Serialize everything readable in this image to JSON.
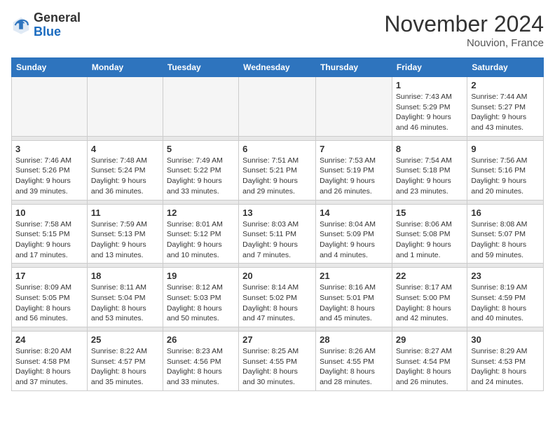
{
  "header": {
    "logo_general": "General",
    "logo_blue": "Blue",
    "month_title": "November 2024",
    "location": "Nouvion, France"
  },
  "columns": [
    "Sunday",
    "Monday",
    "Tuesday",
    "Wednesday",
    "Thursday",
    "Friday",
    "Saturday"
  ],
  "weeks": [
    {
      "days": [
        {
          "num": "",
          "info": "",
          "empty": true
        },
        {
          "num": "",
          "info": "",
          "empty": true
        },
        {
          "num": "",
          "info": "",
          "empty": true
        },
        {
          "num": "",
          "info": "",
          "empty": true
        },
        {
          "num": "",
          "info": "",
          "empty": true
        },
        {
          "num": "1",
          "info": "Sunrise: 7:43 AM\nSunset: 5:29 PM\nDaylight: 9 hours\nand 46 minutes."
        },
        {
          "num": "2",
          "info": "Sunrise: 7:44 AM\nSunset: 5:27 PM\nDaylight: 9 hours\nand 43 minutes."
        }
      ]
    },
    {
      "days": [
        {
          "num": "3",
          "info": "Sunrise: 7:46 AM\nSunset: 5:26 PM\nDaylight: 9 hours\nand 39 minutes."
        },
        {
          "num": "4",
          "info": "Sunrise: 7:48 AM\nSunset: 5:24 PM\nDaylight: 9 hours\nand 36 minutes."
        },
        {
          "num": "5",
          "info": "Sunrise: 7:49 AM\nSunset: 5:22 PM\nDaylight: 9 hours\nand 33 minutes."
        },
        {
          "num": "6",
          "info": "Sunrise: 7:51 AM\nSunset: 5:21 PM\nDaylight: 9 hours\nand 29 minutes."
        },
        {
          "num": "7",
          "info": "Sunrise: 7:53 AM\nSunset: 5:19 PM\nDaylight: 9 hours\nand 26 minutes."
        },
        {
          "num": "8",
          "info": "Sunrise: 7:54 AM\nSunset: 5:18 PM\nDaylight: 9 hours\nand 23 minutes."
        },
        {
          "num": "9",
          "info": "Sunrise: 7:56 AM\nSunset: 5:16 PM\nDaylight: 9 hours\nand 20 minutes."
        }
      ]
    },
    {
      "days": [
        {
          "num": "10",
          "info": "Sunrise: 7:58 AM\nSunset: 5:15 PM\nDaylight: 9 hours\nand 17 minutes."
        },
        {
          "num": "11",
          "info": "Sunrise: 7:59 AM\nSunset: 5:13 PM\nDaylight: 9 hours\nand 13 minutes."
        },
        {
          "num": "12",
          "info": "Sunrise: 8:01 AM\nSunset: 5:12 PM\nDaylight: 9 hours\nand 10 minutes."
        },
        {
          "num": "13",
          "info": "Sunrise: 8:03 AM\nSunset: 5:11 PM\nDaylight: 9 hours\nand 7 minutes."
        },
        {
          "num": "14",
          "info": "Sunrise: 8:04 AM\nSunset: 5:09 PM\nDaylight: 9 hours\nand 4 minutes."
        },
        {
          "num": "15",
          "info": "Sunrise: 8:06 AM\nSunset: 5:08 PM\nDaylight: 9 hours\nand 1 minute."
        },
        {
          "num": "16",
          "info": "Sunrise: 8:08 AM\nSunset: 5:07 PM\nDaylight: 8 hours\nand 59 minutes."
        }
      ]
    },
    {
      "days": [
        {
          "num": "17",
          "info": "Sunrise: 8:09 AM\nSunset: 5:05 PM\nDaylight: 8 hours\nand 56 minutes."
        },
        {
          "num": "18",
          "info": "Sunrise: 8:11 AM\nSunset: 5:04 PM\nDaylight: 8 hours\nand 53 minutes."
        },
        {
          "num": "19",
          "info": "Sunrise: 8:12 AM\nSunset: 5:03 PM\nDaylight: 8 hours\nand 50 minutes."
        },
        {
          "num": "20",
          "info": "Sunrise: 8:14 AM\nSunset: 5:02 PM\nDaylight: 8 hours\nand 47 minutes."
        },
        {
          "num": "21",
          "info": "Sunrise: 8:16 AM\nSunset: 5:01 PM\nDaylight: 8 hours\nand 45 minutes."
        },
        {
          "num": "22",
          "info": "Sunrise: 8:17 AM\nSunset: 5:00 PM\nDaylight: 8 hours\nand 42 minutes."
        },
        {
          "num": "23",
          "info": "Sunrise: 8:19 AM\nSunset: 4:59 PM\nDaylight: 8 hours\nand 40 minutes."
        }
      ]
    },
    {
      "days": [
        {
          "num": "24",
          "info": "Sunrise: 8:20 AM\nSunset: 4:58 PM\nDaylight: 8 hours\nand 37 minutes."
        },
        {
          "num": "25",
          "info": "Sunrise: 8:22 AM\nSunset: 4:57 PM\nDaylight: 8 hours\nand 35 minutes."
        },
        {
          "num": "26",
          "info": "Sunrise: 8:23 AM\nSunset: 4:56 PM\nDaylight: 8 hours\nand 33 minutes."
        },
        {
          "num": "27",
          "info": "Sunrise: 8:25 AM\nSunset: 4:55 PM\nDaylight: 8 hours\nand 30 minutes."
        },
        {
          "num": "28",
          "info": "Sunrise: 8:26 AM\nSunset: 4:55 PM\nDaylight: 8 hours\nand 28 minutes."
        },
        {
          "num": "29",
          "info": "Sunrise: 8:27 AM\nSunset: 4:54 PM\nDaylight: 8 hours\nand 26 minutes."
        },
        {
          "num": "30",
          "info": "Sunrise: 8:29 AM\nSunset: 4:53 PM\nDaylight: 8 hours\nand 24 minutes."
        }
      ]
    }
  ]
}
